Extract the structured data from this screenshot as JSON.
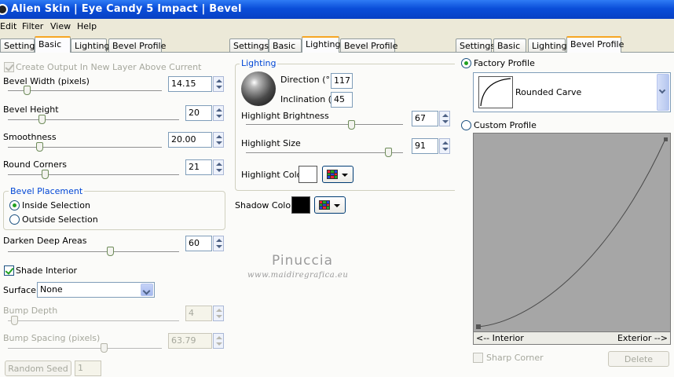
{
  "title": {
    "text": "Alien Skin  |  Eye Candy 5 Impact  |  Bevel"
  },
  "menu": [
    "Edit",
    "Filter",
    "View",
    "Help"
  ],
  "tabs": [
    "Settings",
    "Basic",
    "Lighting",
    "Bevel Profile"
  ],
  "left": {
    "create_output": "Create Output In New Layer Above Current",
    "bevel_width": {
      "label": "Bevel Width (pixels)",
      "value": "14.15",
      "level": 0.12
    },
    "bevel_height": {
      "label": "Bevel Height",
      "value": "20",
      "level": 0.2
    },
    "smoothness": {
      "label": "Smoothness",
      "value": "20.00",
      "level": 0.2
    },
    "round_corners": {
      "label": "Round Corners",
      "value": "21",
      "level": 0.21
    },
    "placement": {
      "title": "Bevel Placement",
      "inside": "Inside Selection",
      "outside": "Outside Selection"
    },
    "darken": {
      "label": "Darken Deep Areas",
      "value": "60",
      "level": 0.6
    },
    "shade_interior": "Shade Interior",
    "surface": {
      "label": "Surface:",
      "value": "None"
    },
    "bump_depth": {
      "label": "Bump Depth",
      "value": "4",
      "level": 0.04
    },
    "bump_spacing": {
      "label": "Bump Spacing (pixels)",
      "value": "63.79",
      "level": 0.56
    },
    "random_seed": {
      "label": "Random Seed",
      "value": "1"
    }
  },
  "mid": {
    "lighting_title": "Lighting",
    "direction": {
      "label": "Direction (°)",
      "value": "117"
    },
    "inclination": {
      "label": "Inclination (°)",
      "value": "45"
    },
    "highlight_brightness": {
      "label": "Highlight Brightness",
      "value": "67",
      "level": 0.67
    },
    "highlight_size": {
      "label": "Highlight Size",
      "value": "91",
      "level": 0.91
    },
    "highlight_color": {
      "label": "Highlight Color",
      "color": "#ffffff"
    },
    "shadow_color": {
      "label": "Shadow Color",
      "color": "#000000"
    },
    "watermark": {
      "name": "Pinuccia",
      "url": "www.maidiregrafica.eu"
    }
  },
  "right": {
    "factory": "Factory Profile",
    "profile_name": "Rounded Carve",
    "custom": "Custom Profile",
    "interior": "<-- Interior",
    "exterior": "Exterior -->",
    "sharp_corner": "Sharp Corner",
    "delete": "Delete"
  },
  "colors": {
    "accent": "#f6a623",
    "title_bar": "#0a4ed9",
    "check": "#21a121",
    "group_title": "#0046d5",
    "profile_bg": "#a6a6a6"
  }
}
